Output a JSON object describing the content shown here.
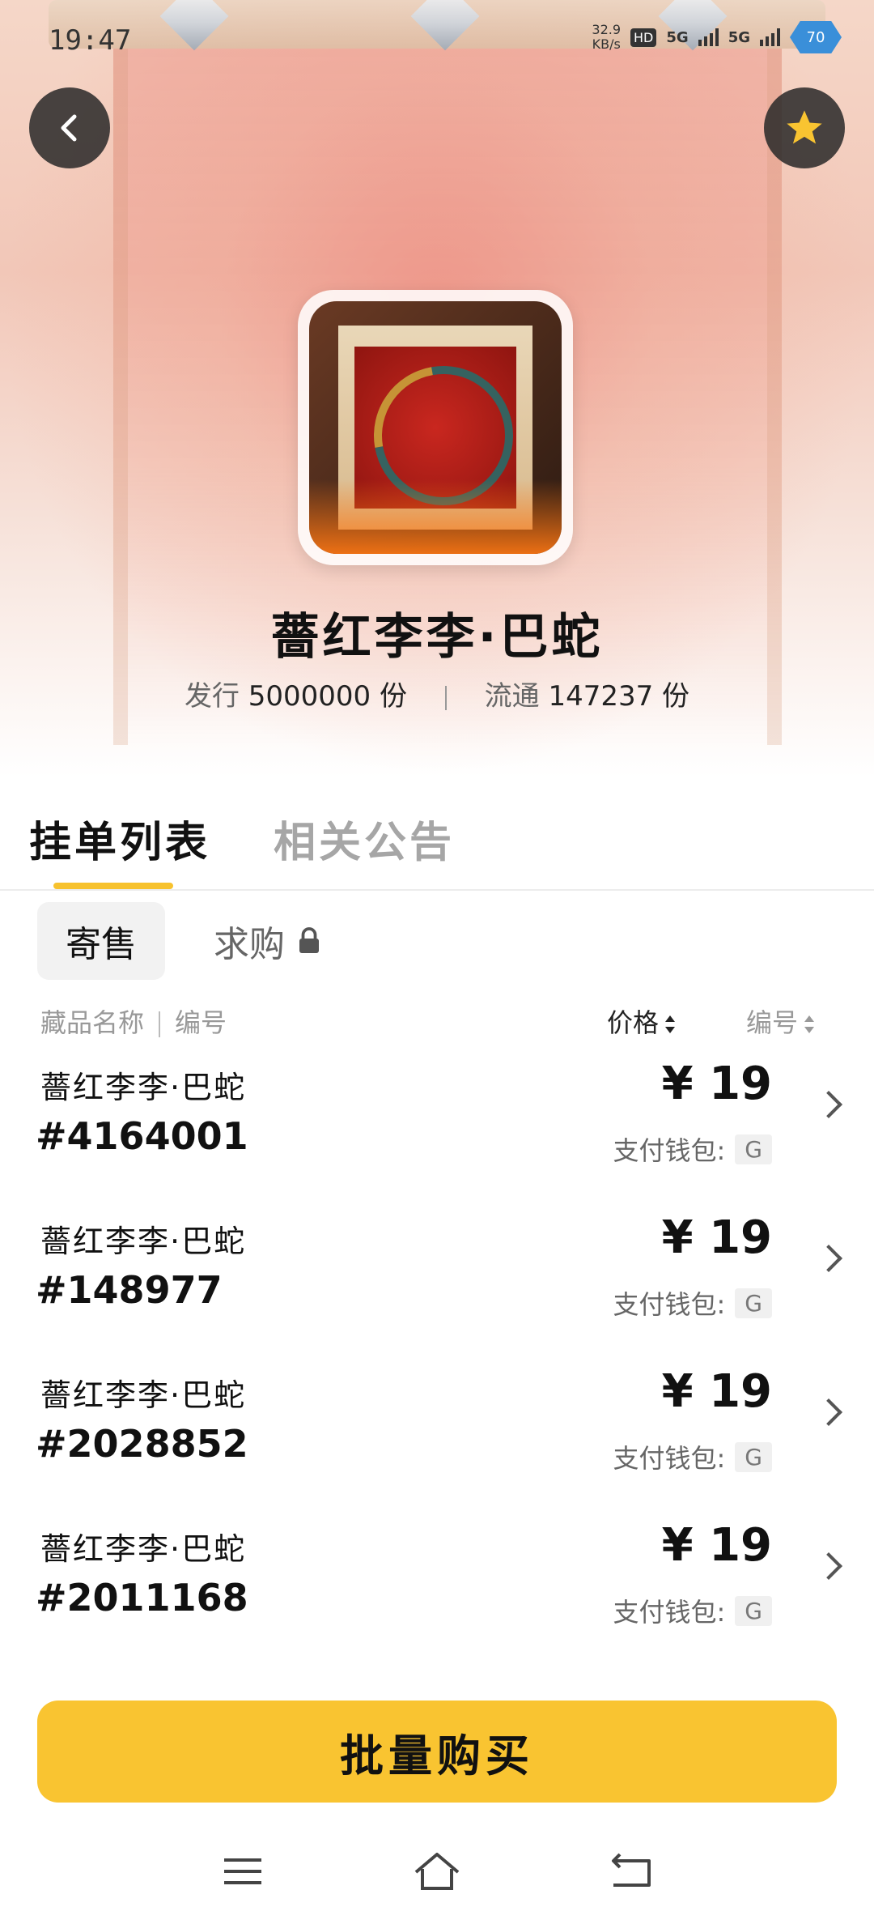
{
  "status_bar": {
    "time": "19:47",
    "speed_value": "32.9",
    "speed_unit": "KB/s",
    "hd": "HD",
    "net1": "5G",
    "net2": "5G",
    "battery": "70"
  },
  "header": {
    "title": "薔红李李·巴蛇",
    "issued_label": "发行",
    "issued_value": "5000000",
    "issued_unit": "份",
    "circulation_label": "流通",
    "circulation_value": "147237",
    "circulation_unit": "份"
  },
  "tabs": [
    {
      "label": "挂单列表"
    },
    {
      "label": "相关公告"
    }
  ],
  "subtabs": {
    "sell": "寄售",
    "buy": "求购"
  },
  "list_header": {
    "name": "藏品名称",
    "serial": "编号",
    "price": "价格",
    "number_sort": "编号"
  },
  "listings": [
    {
      "name": "薔红李李·巴蛇",
      "serial": "#4164001",
      "price": "¥ 19",
      "wallet_label": "支付钱包:",
      "wallet_badge": "G"
    },
    {
      "name": "薔红李李·巴蛇",
      "serial": "#148977",
      "price": "¥ 19",
      "wallet_label": "支付钱包:",
      "wallet_badge": "G"
    },
    {
      "name": "薔红李李·巴蛇",
      "serial": "#2028852",
      "price": "¥ 19",
      "wallet_label": "支付钱包:",
      "wallet_badge": "G"
    },
    {
      "name": "薔红李李·巴蛇",
      "serial": "#2011168",
      "price": "¥ 19",
      "wallet_label": "支付钱包:",
      "wallet_badge": "G"
    }
  ],
  "bottom": {
    "batch_buy": "批量购买"
  },
  "icons": {
    "back": "chevron-left-icon",
    "favorite": "star-icon",
    "lock": "lock-icon",
    "menu": "menu-icon",
    "home": "home-icon",
    "back_nav": "back-arrow-icon"
  },
  "colors": {
    "accent": "#f9c431",
    "indicator": "#f7c22e",
    "star": "#f9c431",
    "battery": "#3a8fd9"
  }
}
